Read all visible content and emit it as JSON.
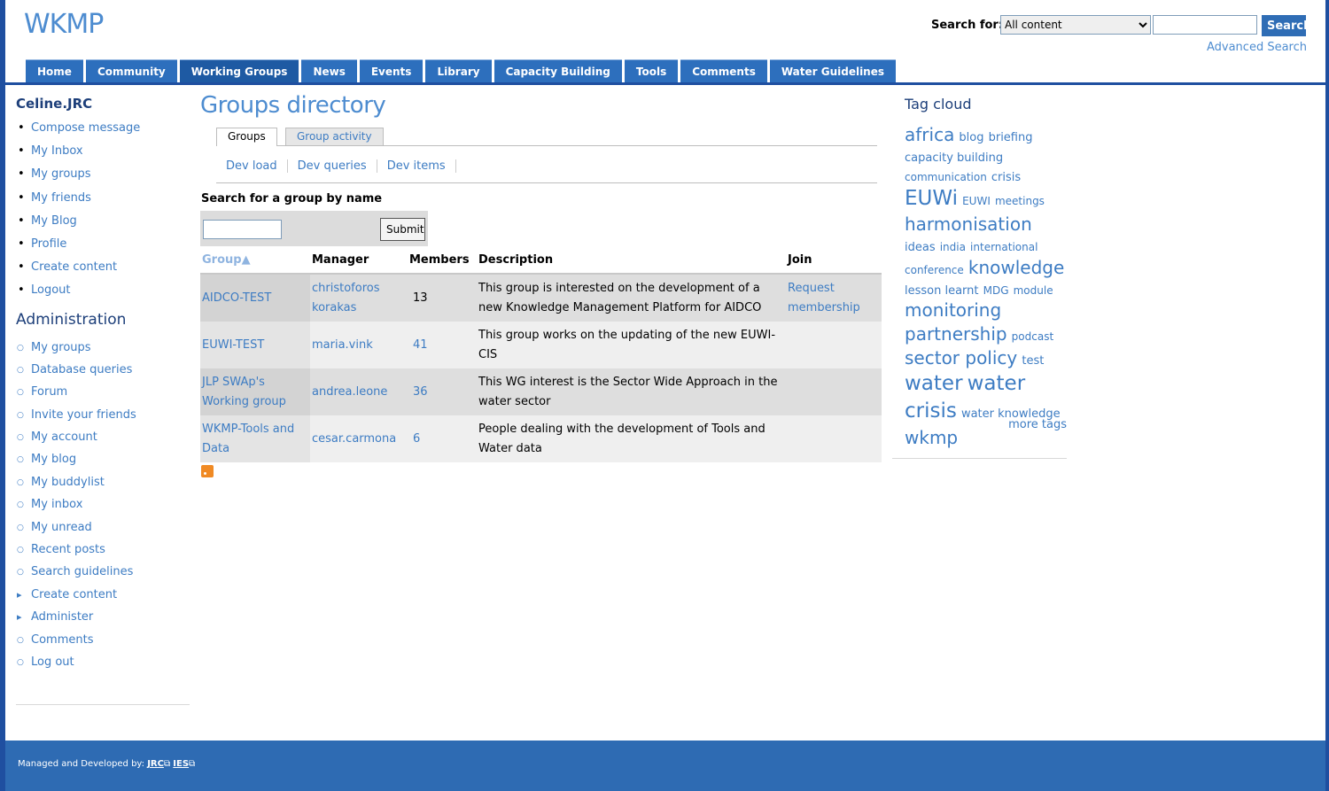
{
  "header": {
    "logo": "WKMP",
    "search_label": "Search for:",
    "search_scope": "All content",
    "search_button": "Search",
    "advanced_search": "Advanced Search"
  },
  "nav": {
    "tabs": [
      "Home",
      "Community",
      "Working Groups",
      "News",
      "Events",
      "Library",
      "Capacity Building",
      "Tools",
      "Comments",
      "Water Guidelines"
    ],
    "active": "Working Groups"
  },
  "sidebar": {
    "username": "Celine.JRC",
    "user_links": [
      "Compose message",
      "My Inbox",
      "My groups",
      "My friends",
      "My Blog",
      "Profile",
      "Create content",
      "Logout"
    ],
    "admin_title": "Administration",
    "admin_links": [
      "My groups",
      "Database queries",
      "Forum",
      "Invite your friends",
      "My account",
      "My blog",
      "My buddylist",
      "My inbox",
      "My unread",
      "Recent posts",
      "Search guidelines",
      "Create content",
      "Administer",
      "Comments",
      "Log out"
    ]
  },
  "main": {
    "title": "Groups directory",
    "tabs": [
      "Groups",
      "Group activity"
    ],
    "subnav": [
      "Dev load",
      "Dev queries",
      "Dev items"
    ],
    "search_label": "Search for a group by name",
    "submit": "Submit",
    "columns": [
      "Group",
      "Manager",
      "Members",
      "Description",
      "Join"
    ],
    "rows": [
      {
        "group": "AIDCO-TEST",
        "manager": "christoforos korakas",
        "members": "13",
        "description": "This group is interested on the development of a new Knowledge Management Platform for AIDCO",
        "join": "Request membership"
      },
      {
        "group": "EUWI-TEST",
        "manager": "maria.vink",
        "members": "41",
        "description": "This group works on the updating of the new EUWI-CIS",
        "join": ""
      },
      {
        "group": "JLP SWAp's Working group",
        "manager": "andrea.leone",
        "members": "36",
        "description": "This WG interest is the Sector Wide Approach in the water sector",
        "join": ""
      },
      {
        "group": "WKMP-Tools and Data",
        "manager": "cesar.carmona",
        "members": "6",
        "description": "People dealing with the development of Tools and Water data",
        "join": ""
      }
    ]
  },
  "tags": {
    "title": "Tag cloud",
    "items": [
      {
        "t": "africa",
        "w": 5
      },
      {
        "t": "blog",
        "w": 2
      },
      {
        "t": "briefing",
        "w": 2
      },
      {
        "t": "capacity building",
        "w": 2
      },
      {
        "t": "communication",
        "w": 1
      },
      {
        "t": "crisis",
        "w": 2
      },
      {
        "t": "EUWi",
        "w": 6
      },
      {
        "t": "EUWI",
        "w": 1
      },
      {
        "t": "meetings",
        "w": 1
      },
      {
        "t": "harmonisation",
        "w": 5
      },
      {
        "t": "ideas",
        "w": 2
      },
      {
        "t": "india",
        "w": 1
      },
      {
        "t": "international conference",
        "w": 1
      },
      {
        "t": "knowledge",
        "w": 5
      },
      {
        "t": "lesson learnt",
        "w": 2
      },
      {
        "t": "MDG",
        "w": 1
      },
      {
        "t": "module",
        "w": 1
      },
      {
        "t": "monitoring",
        "w": 5
      },
      {
        "t": "partnership",
        "w": 5
      },
      {
        "t": "podcast",
        "w": 1
      },
      {
        "t": "sector policy",
        "w": 5
      },
      {
        "t": "test",
        "w": 2
      },
      {
        "t": "water",
        "w": 6
      },
      {
        "t": "water crisis",
        "w": 6
      },
      {
        "t": "water knowledge",
        "w": 2
      },
      {
        "t": "wkmp",
        "w": 5
      }
    ],
    "more": "more tags"
  },
  "footer": {
    "text": "Managed and Developed by:",
    "link1": "JRC",
    "link2": "IES"
  },
  "colors": {
    "brand": "#2e6bb3",
    "link": "#3d7cc3",
    "logo": "#4d8cd0"
  }
}
